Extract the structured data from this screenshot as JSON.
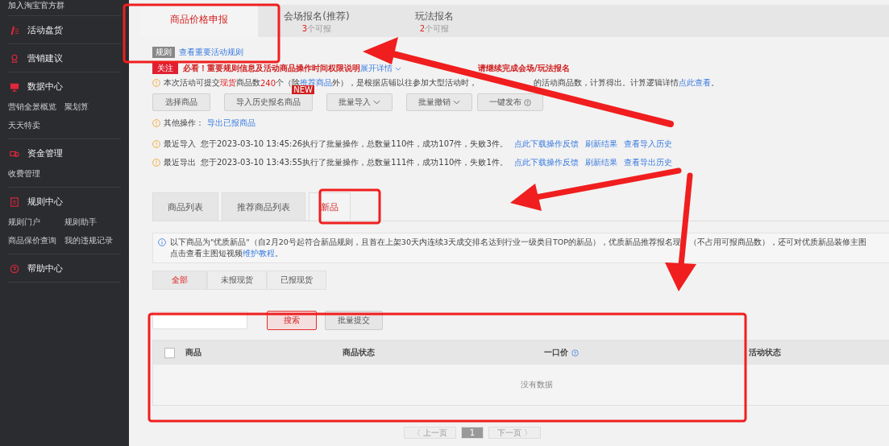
{
  "sidebar": {
    "cut_item": "加入淘宝官方群",
    "sections": [
      {
        "title": "活动盘货"
      },
      {
        "title": "营销建议"
      },
      {
        "title": "数据中心",
        "links": [
          "营销全景概览",
          "聚划算",
          "天天特卖"
        ]
      },
      {
        "title": "资金管理",
        "links": [
          "收费管理"
        ]
      },
      {
        "title": "规则中心",
        "links": [
          "规则门户",
          "规则助手",
          "商品保价查询",
          "我的违规记录"
        ]
      },
      {
        "title": "帮助中心"
      }
    ]
  },
  "top_tabs": [
    {
      "label": "商品价格申报",
      "selected": true
    },
    {
      "label": "会场报名(推荐)",
      "count": "3",
      "count_suffix": "个可报",
      "selected": false
    },
    {
      "label": "玩法报名",
      "count": "2",
      "count_suffix": "个可报",
      "selected": false
    }
  ],
  "rules": {
    "tag": "规则",
    "link": "查看重要活动规则"
  },
  "notice": {
    "tag": "关注",
    "text": "必看！重要规则信息及活动商品操作时间权限说明",
    "link": "展开详情",
    "tail": "请继续完成会场/玩法报名"
  },
  "info_line": [
    {
      "kind": "text",
      "text": "本次活动可提交"
    },
    {
      "kind": "red",
      "text": "现货"
    },
    {
      "kind": "text",
      "text": "商品数"
    },
    {
      "kind": "red",
      "text": "240"
    },
    {
      "kind": "text",
      "text": "个（除"
    },
    {
      "kind": "link",
      "text": "推荐商品"
    },
    {
      "kind": "text",
      "text": "外），是根据店铺以往参加大型活动时，"
    },
    {
      "kind": "gap",
      "text": "的活动商品数，计算得出。计算逻辑详情"
    },
    {
      "kind": "link",
      "text": "点此查看"
    },
    {
      "kind": "text",
      "text": "。"
    }
  ],
  "buttons": [
    {
      "label": "选择商品",
      "kind": "plain"
    },
    {
      "label": "导入历史报名商品",
      "kind": "plain",
      "badge": "NEW"
    },
    {
      "label": "批量导入",
      "kind": "dropdown"
    },
    {
      "label": "批量撤销",
      "kind": "dropdown"
    },
    {
      "label": "一键发布",
      "kind": "help"
    }
  ],
  "other_ops": {
    "label": "其他操作：",
    "link": "导出已报商品"
  },
  "logs": [
    {
      "title": "最近导入",
      "text": "您于2023-03-10 13:45:26执行了批量操作，总数量110件，成功107件，失败3件。",
      "links": [
        "点此下载操作反馈",
        "刷新结果",
        "查看导入历史"
      ]
    },
    {
      "title": "最近导出",
      "text": "您于2023-03-10 13:43:55执行了批量操作，总数量111件，成功110件，失败1件。",
      "links": [
        "点此下载操作反馈",
        "刷新结果",
        "查看导出历史"
      ]
    }
  ],
  "list_tabs": [
    {
      "label": "商品列表",
      "selected": false
    },
    {
      "label": "推荐商品列表",
      "selected": false
    },
    {
      "label": "新品",
      "selected": true
    }
  ],
  "tip": {
    "line_1a": "以下商品为\"优质新品\"（自2月20号起符合新品规则，且首在上架30天内连续3天成交排名达到行业一级类目TOP的新品），优质新品推荐报名现",
    "line_1b": "（不占用可报商品数），还可对优质新品装修主图",
    "line_2": "点击查看主图短视频",
    "link": "维护教程",
    "end": "。"
  },
  "filters": [
    {
      "label": "全部",
      "selected": true
    },
    {
      "label": "未报现货",
      "selected": false
    },
    {
      "label": "已报现货",
      "selected": false
    }
  ],
  "actions": {
    "search": "搜索",
    "submit": "批量提交"
  },
  "table": {
    "checked": false,
    "columns": [
      "商品",
      "商品状态",
      "一口价",
      "活动状态"
    ],
    "empty": "没有数据"
  },
  "pagination": {
    "prev": "〈 上一页",
    "page": "1",
    "next": "下一页 〉"
  }
}
